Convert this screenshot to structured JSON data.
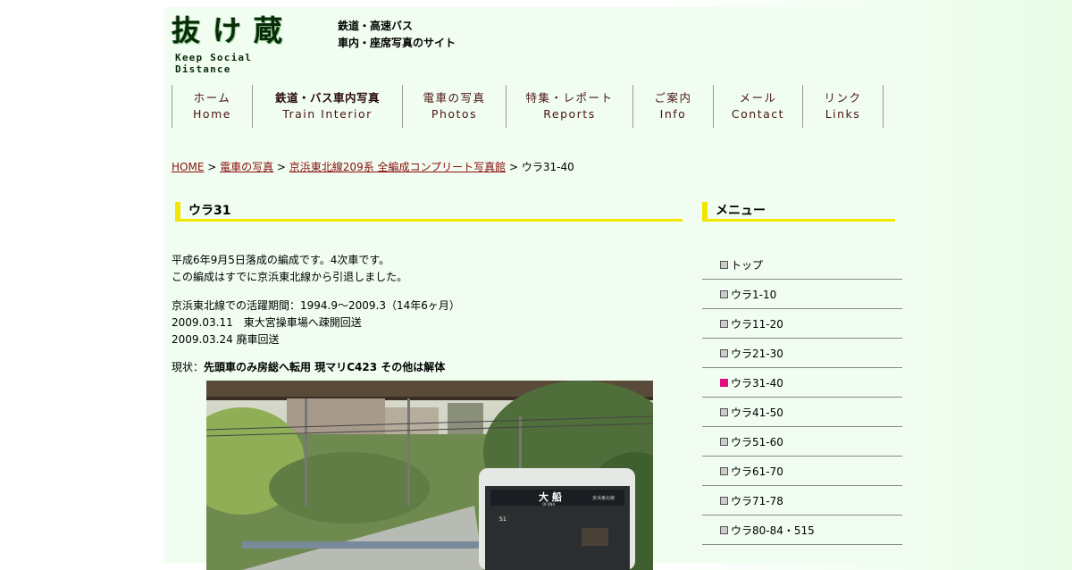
{
  "header": {
    "logo_text": "抜け蔵",
    "logo_sub": "Keep Social Distance",
    "tagline_line1": "鉄道・高速バス",
    "tagline_line2": "車内・座席写真のサイト"
  },
  "nav": [
    {
      "ja": "ホーム",
      "en": "Home"
    },
    {
      "ja": "鉄道・バス車内写真",
      "en": "Train Interior"
    },
    {
      "ja": "電車の写真",
      "en": "Photos"
    },
    {
      "ja": "特集・レポート",
      "en": "Reports"
    },
    {
      "ja": "ご案内",
      "en": "Info"
    },
    {
      "ja": "メール",
      "en": "Contact"
    },
    {
      "ja": "リンク",
      "en": "Links"
    }
  ],
  "breadcrumb": {
    "home": "HOME",
    "sep": " > ",
    "photos": "電車の写真",
    "series": "京浜東北線209系 全編成コンプリート写真館",
    "current": "ウラ31-40"
  },
  "main": {
    "title": "ウラ31",
    "p1_line1": "平成6年9月5日落成の編成です。4次車です。",
    "p1_line2": "この編成はすでに京浜東北線から引退しました。",
    "p2_line1": "京浜東北線での活躍期間：1994.9～2009.3（14年6ヶ月）",
    "p2_line2": "2009.03.11　東大宮操車場へ疎開回送",
    "p2_line3": "2009.03.24 廃車回送",
    "p3_label": "現状：",
    "p3_bold": "先頭車のみ房総へ転用 現マリC423 その他は解体",
    "photo_dest_ja": "大 船",
    "photo_dest_en": "OFUNA",
    "photo_line": "京浜東北線",
    "photo_number": "51"
  },
  "sidebar": {
    "title": "メニュー",
    "items": [
      "トップ",
      "ウラ1-10",
      "ウラ11-20",
      "ウラ21-30",
      "ウラ31-40",
      "ウラ41-50",
      "ウラ51-60",
      "ウラ61-70",
      "ウラ71-78",
      "ウラ80-84・515"
    ],
    "active_index": 4
  },
  "colors": {
    "page_bg": "#f0fdf0",
    "heading_bar": "#f2e600",
    "link": "#8b1010",
    "active_marker": "#e0107a"
  }
}
